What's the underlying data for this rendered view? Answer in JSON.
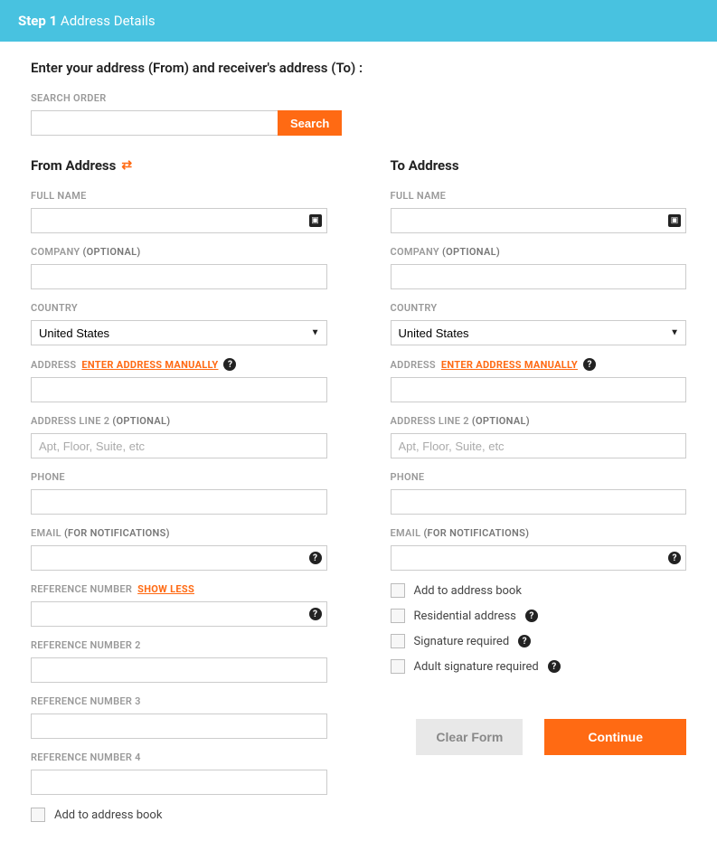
{
  "step": {
    "prefix": "Step 1",
    "title": "Address Details"
  },
  "intro": "Enter your address (From) and receiver's address (To) :",
  "search": {
    "label": "SEARCH ORDER",
    "value": "",
    "button": "Search"
  },
  "from": {
    "title": "From Address",
    "full_name": {
      "label": "FULL NAME",
      "value": ""
    },
    "company": {
      "label": "COMPANY",
      "opt": "(OPTIONAL)",
      "value": ""
    },
    "country": {
      "label": "COUNTRY",
      "value": "United States"
    },
    "address": {
      "label": "ADDRESS",
      "link": "ENTER ADDRESS MANUALLY",
      "value": ""
    },
    "address2": {
      "label": "ADDRESS LINE 2",
      "opt": "(OPTIONAL)",
      "placeholder": "Apt, Floor, Suite, etc",
      "value": ""
    },
    "phone": {
      "label": "PHONE",
      "value": ""
    },
    "email": {
      "label": "EMAIL",
      "opt": "(FOR NOTIFICATIONS)",
      "value": ""
    },
    "ref1": {
      "label": "REFERENCE NUMBER",
      "link": "SHOW LESS",
      "value": ""
    },
    "ref2": {
      "label": "REFERENCE NUMBER 2",
      "value": ""
    },
    "ref3": {
      "label": "REFERENCE NUMBER 3",
      "value": ""
    },
    "ref4": {
      "label": "REFERENCE NUMBER 4",
      "value": ""
    },
    "add_to_book": "Add to address book"
  },
  "to": {
    "title": "To Address",
    "full_name": {
      "label": "FULL NAME",
      "value": ""
    },
    "company": {
      "label": "COMPANY",
      "opt": "(OPTIONAL)",
      "value": ""
    },
    "country": {
      "label": "COUNTRY",
      "value": "United States"
    },
    "address": {
      "label": "ADDRESS",
      "link": "ENTER ADDRESS MANUALLY",
      "value": ""
    },
    "address2": {
      "label": "ADDRESS LINE 2",
      "opt": "(OPTIONAL)",
      "placeholder": "Apt, Floor, Suite, etc",
      "value": ""
    },
    "phone": {
      "label": "PHONE",
      "value": ""
    },
    "email": {
      "label": "EMAIL",
      "opt": "(FOR NOTIFICATIONS)",
      "value": ""
    },
    "add_to_book": "Add to address book",
    "residential": "Residential address",
    "signature": "Signature required",
    "adult_signature": "Adult signature required"
  },
  "footer": {
    "clear": "Clear Form",
    "continue": "Continue"
  }
}
